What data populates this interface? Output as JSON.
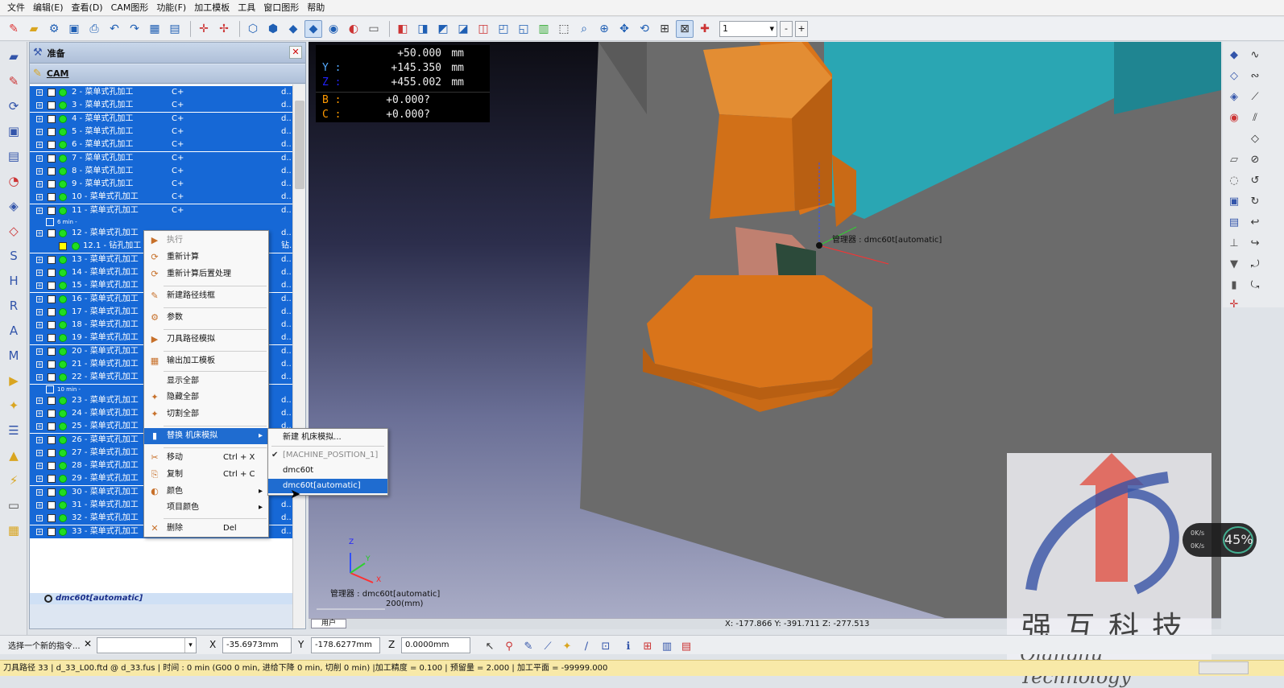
{
  "menu": [
    "文件",
    "编辑(E)",
    "查看(D)",
    "CAM图形",
    "功能(F)",
    "加工模板",
    "工具",
    "窗口图形",
    "帮助"
  ],
  "toolbar": {
    "zoom_value": "1"
  },
  "panel": {
    "header1": "准备",
    "header2": "CAM"
  },
  "tree": {
    "rows_a": [
      {
        "name": "2 - 菜单式孔加工",
        "code": "C+",
        "d": "d.."
      },
      {
        "name": "3 - 菜单式孔加工",
        "code": "C+",
        "d": "d.."
      },
      {
        "name": "4 - 菜单式孔加工",
        "code": "C+",
        "d": "d.."
      },
      {
        "name": "5 - 菜单式孔加工",
        "code": "C+",
        "d": "d.."
      },
      {
        "name": "6 - 菜单式孔加工",
        "code": "C+",
        "d": "d.."
      },
      {
        "name": "7 - 菜单式孔加工",
        "code": "C+",
        "d": "d.."
      },
      {
        "name": "8 - 菜单式孔加工",
        "code": "C+",
        "d": "d.."
      },
      {
        "name": "9 - 菜单式孔加工",
        "code": "C+",
        "d": "d.."
      },
      {
        "name": "10 - 菜单式孔加工",
        "code": "C+",
        "d": "d.."
      },
      {
        "name": "11 - 菜单式孔加工",
        "code": "C+",
        "d": "d.."
      }
    ],
    "group1": "6 min -",
    "rows_b": [
      {
        "name": "12 - 菜单式孔加工",
        "d": "d.."
      },
      {
        "name": "12.1 - 钻孔加工",
        "d": "钻.."
      },
      {
        "name": "13 - 菜单式孔加工",
        "d": "d.."
      },
      {
        "name": "14 - 菜单式孔加工",
        "d": "d.."
      },
      {
        "name": "15 - 菜单式孔加工",
        "d": "d.."
      },
      {
        "name": "16 - 菜单式孔加工",
        "d": "d.."
      },
      {
        "name": "17 - 菜单式孔加工",
        "d": "d.."
      },
      {
        "name": "18 - 菜单式孔加工",
        "d": "d.."
      },
      {
        "name": "19 - 菜单式孔加工",
        "d": "d.."
      },
      {
        "name": "20 - 菜单式孔加工",
        "d": "d.."
      },
      {
        "name": "21 - 菜单式孔加工",
        "d": "d.."
      },
      {
        "name": "22 - 菜单式孔加工",
        "d": "d.."
      }
    ],
    "group2": "10 min -",
    "rows_c": [
      {
        "name": "23 - 菜单式孔加工",
        "d": "d.."
      },
      {
        "name": "24 - 菜单式孔加工",
        "d": "d.."
      },
      {
        "name": "25 - 菜单式孔加工",
        "d": "d.."
      },
      {
        "name": "26 - 菜单式孔加工",
        "d": "d.."
      },
      {
        "name": "27 - 菜单式孔加工",
        "d": "d.."
      },
      {
        "name": "28 - 菜单式孔加工",
        "d": "d.."
      },
      {
        "name": "29 - 菜单式孔加工",
        "d": "d.."
      },
      {
        "name": "30 - 菜单式孔加工",
        "d": "d.."
      },
      {
        "name": "31 - 菜单式孔加工",
        "d": "d.."
      },
      {
        "name": "32 - 菜单式孔加工",
        "d": "d.."
      },
      {
        "name": "33 - 菜单式孔加工",
        "d": "d.."
      }
    ],
    "last": "dmc60t[automatic]"
  },
  "context_menu": [
    {
      "label": "执行",
      "disabled": true
    },
    {
      "label": "重新计算"
    },
    {
      "label": "重新计算后置处理"
    },
    {
      "label": "新建路径线框"
    },
    {
      "label": "参数"
    },
    {
      "label": "刀具路径模拟"
    },
    {
      "label": "输出加工模板"
    },
    {
      "label": "显示全部"
    },
    {
      "label": "隐藏全部"
    },
    {
      "label": "切割全部"
    },
    {
      "label": "替换 机床模拟"
    },
    {
      "label": "移动",
      "shortcut": "Ctrl + X"
    },
    {
      "label": "复制",
      "shortcut": "Ctrl + C"
    },
    {
      "label": "颜色"
    },
    {
      "label": "项目颜色"
    },
    {
      "label": "删除",
      "shortcut": "Del"
    }
  ],
  "submenu": [
    "新建 机床模拟...",
    "[MACHINE_POSITION_1]",
    "dmc60t",
    "dmc60t[automatic]"
  ],
  "dro": {
    "x_value": "+50.000",
    "x_unit": "mm",
    "y_label": "Y :",
    "y_value": "+145.350",
    "y_unit": "mm",
    "z_label": "Z :",
    "z_value": "+455.002",
    "z_unit": "mm",
    "b_label": "B :",
    "b_value": "+0.000?",
    "c_label": "C :",
    "c_value": "+0.000?"
  },
  "viewport": {
    "machine_label": "管理器 : dmc60t[automatic]",
    "triad_label": "管理器 : dmc60t[automatic]",
    "scale": "200(mm)",
    "axis_z": "Z",
    "axis_y": "Y",
    "axis_x": "X"
  },
  "status_xyz": "X: -177.866   Y: -391.711   Z: -277.513",
  "view_tab": "用户",
  "cmd": {
    "prompt": "选择一个新的指令...",
    "x_label": "X",
    "x_value": "-35.6973mm",
    "y_label": "Y",
    "y_value": "-178.6277mm",
    "z_label": "Z",
    "z_value": "0.0000mm"
  },
  "infobar": "刀具路径 33 | d_33_L00.ftd @ d_33.fus | 时间 : 0 min (G00 0 min, 进给下降 0 min, 切削 0 min) |加工精度 = 0.100 | 预留量 = 2.000 | 加工平面 = -99999.000",
  "watermark": {
    "title": "强互科技",
    "subtitle": "Qianghu Technology"
  },
  "cpu": {
    "percent": "45%",
    "s1": "0K/s",
    "s2": "0K/s"
  },
  "colors": {
    "selection": "#1668d6",
    "machine_orange": "#d9741a",
    "machine_teal": "#2aa6b3",
    "plate_gray": "#6b6b6b"
  }
}
